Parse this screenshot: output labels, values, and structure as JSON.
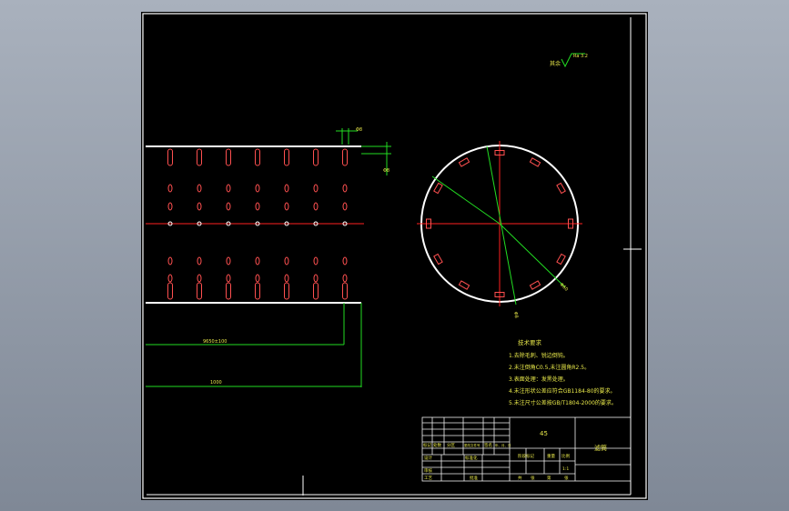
{
  "drawing": {
    "roughness_label": "其余",
    "roughness_value": "Ra 3.2",
    "dim_top_small": "Φ8",
    "dim_inner_length": "9650±100",
    "dim_total_length": "1000",
    "dim_circle_right": "Φ60",
    "dim_circle_bottom": "Φ8"
  },
  "tech_requirements": {
    "title": "技术要求",
    "items": [
      "1.去除毛刺、锐边倒钝。",
      "2.未注倒角C0.5,未注圆角R2.5。",
      "3.表面处理：发黑处理。",
      "4.未注形状公差应符合GB1184-80的要求。",
      "5.未注尺寸公差按GB/T1804-2000的要求。"
    ]
  },
  "title_block": {
    "material": "45",
    "part_name": "滤筒",
    "scale": "1:1",
    "headers": [
      "标记",
      "处数",
      "分区",
      "更改文件号",
      "签名",
      "年、月、日"
    ],
    "labels": {
      "design": "设计",
      "standard": "标准化",
      "review": "审核",
      "process": "工艺",
      "approve": "批准",
      "stage": "阶段标记",
      "weight": "重量",
      "ratio": "比例",
      "sheets": "共",
      "sheet": "张",
      "of": "第",
      "page": "张"
    }
  },
  "colors": {
    "outline": "#ffffff",
    "slot": "#ff3b3b",
    "center_line": "#ff2020",
    "dimension": "#22dd22",
    "text": "#e8e84a",
    "frame": "#f0f0f0"
  }
}
